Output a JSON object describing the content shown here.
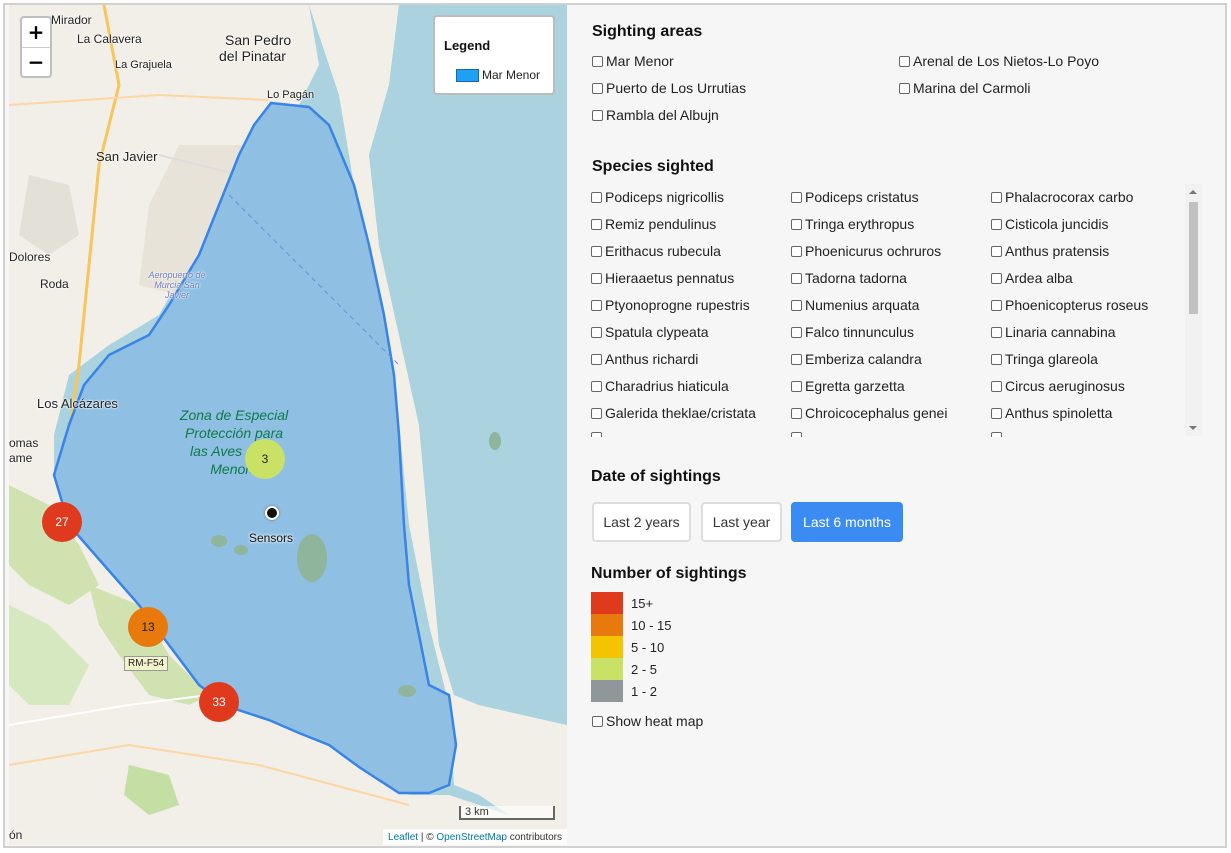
{
  "map": {
    "zoom_in": "+",
    "zoom_out": "−",
    "legend_title": "Legend",
    "legend_item": "Mar Menor",
    "legend_color": "#1da1f2",
    "place_labels": [
      "Mirador",
      "La Calavera",
      "San Pedro",
      "del Pinatar",
      "La Grajuela",
      "Lo Pagán",
      "San Javier",
      "Dolores",
      "Roda",
      "Los Alcázares",
      "omas",
      "ame",
      "ón"
    ],
    "zepa_label": "Zona de Especial Protección para las Aves «Mar Menor»",
    "airport_label": "Aeropuerto de Murcia San Javier",
    "road_tag": "RM-F54",
    "clusters": [
      {
        "count": "27",
        "color": "#e03a1e"
      },
      {
        "count": "13",
        "color": "#e8790c"
      },
      {
        "count": "33",
        "color": "#e03a1e"
      },
      {
        "count": "3",
        "color": "#c9e265"
      }
    ],
    "sensor_label": "Sensors",
    "scale": "3 km",
    "attribution_leaflet": "Leaflet",
    "attribution_sep": " | © ",
    "attribution_osm": "OpenStreetMap",
    "attribution_tail": " contributors"
  },
  "areas": {
    "title": "Sighting areas",
    "items": [
      "Mar Menor",
      "Arenal de Los Nietos-Lo Poyo",
      "Puerto de Los Urrutias",
      "Marina del Carmoli",
      "Rambla del Albujn"
    ]
  },
  "species": {
    "title": "Species sighted",
    "items": [
      "Podiceps nigricollis",
      "Podiceps cristatus",
      "Phalacrocorax carbo",
      "Remiz pendulinus",
      "Tringa erythropus",
      "Cisticola juncidis",
      "Erithacus rubecula",
      "Phoenicurus ochruros",
      "Anthus pratensis",
      "Hieraaetus pennatus",
      "Tadorna tadorna",
      "Ardea alba",
      "Ptyonoprogne rupestris",
      "Numenius arquata",
      "Phoenicopterus roseus",
      "Spatula clypeata",
      "Falco tinnunculus",
      "Linaria cannabina",
      "Anthus richardi",
      "Emberiza calandra",
      "Tringa glareola",
      "Charadrius hiaticula",
      "Egretta garzetta",
      "Circus aeruginosus",
      "Galerida theklae/cristata",
      "Chroicocephalus genei",
      "Anthus spinoletta"
    ]
  },
  "date": {
    "title": "Date of sightings",
    "buttons": [
      "Last 2 years",
      "Last year",
      "Last 6 months"
    ],
    "active": "Last 6 months"
  },
  "count_legend": {
    "title": "Number of sightings",
    "rows": [
      {
        "label": "15+",
        "color": "#e03a1e"
      },
      {
        "label": "10 - 15",
        "color": "#e8790c"
      },
      {
        "label": "5 - 10",
        "color": "#f5c400"
      },
      {
        "label": "2 - 5",
        "color": "#c9e265"
      },
      {
        "label": "1 - 2",
        "color": "#8f979a"
      }
    ],
    "heatmap_label": "Show heat map"
  }
}
